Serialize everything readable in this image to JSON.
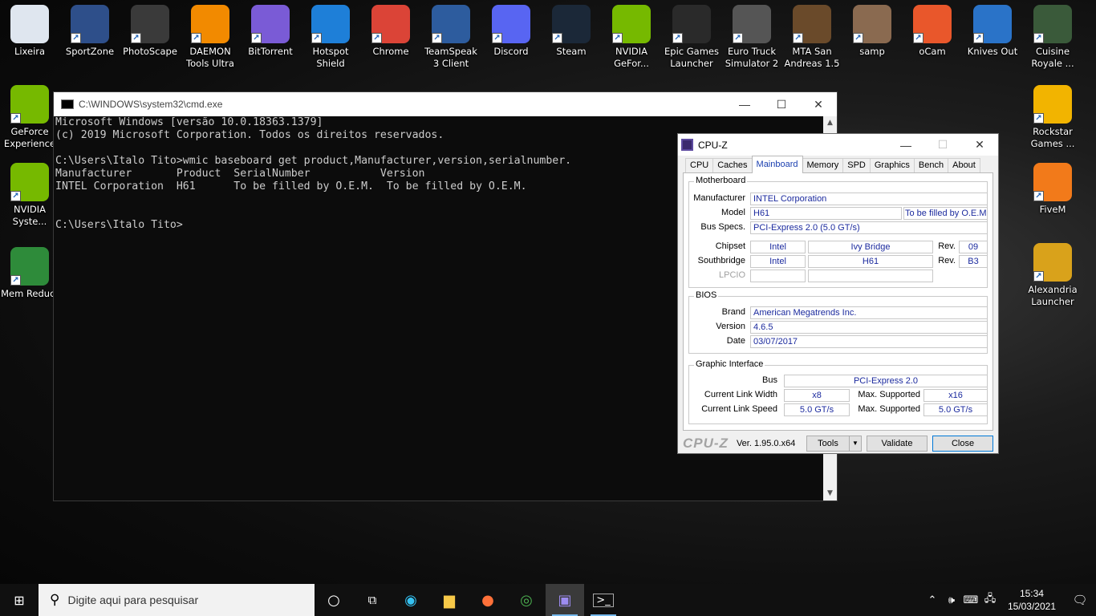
{
  "desktop_icons": [
    {
      "label": "Lixeira",
      "icon": "recycle-bin-icon",
      "color": "#dfe6ef"
    },
    {
      "label": "SportZone",
      "icon": "soccer-ball-icon",
      "color": "#2e4f8a"
    },
    {
      "label": "PhotoScape",
      "icon": "photoscape-icon",
      "color": "#3a3a3a"
    },
    {
      "label": "DAEMON Tools Ultra",
      "icon": "lightning-bolt-icon",
      "color": "#f28a00"
    },
    {
      "label": "BitTorrent",
      "icon": "bittorrent-icon",
      "color": "#7a5bd6"
    },
    {
      "label": "Hotspot Shield",
      "icon": "shield-icon",
      "color": "#1e7fd8"
    },
    {
      "label": "Chrome",
      "icon": "chrome-icon",
      "color": "#db4437"
    },
    {
      "label": "TeamSpeak 3 Client",
      "icon": "teamspeak-icon",
      "color": "#2d5c9e"
    },
    {
      "label": "Discord",
      "icon": "discord-icon",
      "color": "#5865f2"
    },
    {
      "label": "Steam",
      "icon": "steam-icon",
      "color": "#1b2838"
    },
    {
      "label": "NVIDIA GeFor...",
      "icon": "nvidia-icon",
      "color": "#76b900"
    },
    {
      "label": "Epic Games Launcher",
      "icon": "epic-games-icon",
      "color": "#2a2a2a"
    },
    {
      "label": "Euro Truck Simulator 2",
      "icon": "truck-icon",
      "color": "#555555"
    },
    {
      "label": "MTA San Andreas 1.5",
      "icon": "mta-icon",
      "color": "#6a4a2a"
    },
    {
      "label": "samp",
      "icon": "samp-icon",
      "color": "#8a6a50"
    },
    {
      "label": "oCam",
      "icon": "ocam-icon",
      "color": "#e9572b"
    },
    {
      "label": "Knives Out",
      "icon": "knives-out-icon",
      "color": "#2a73c8"
    },
    {
      "label": "Cuisine Royale ...",
      "icon": "cuisine-royale-icon",
      "color": "#3a5a3a"
    },
    {
      "label": "GeForce Experience",
      "icon": "nvidia-icon",
      "color": "#76b900"
    },
    {
      "label": "NVIDIA Syste...",
      "icon": "nvidia-icon",
      "color": "#76b900"
    },
    {
      "label": "Mem Reduct",
      "icon": "memory-chip-icon",
      "color": "#2e8b3a"
    },
    {
      "label": "Rockstar Games ...",
      "icon": "rockstar-icon",
      "color": "#f2b400"
    },
    {
      "label": "FiveM",
      "icon": "fivem-icon",
      "color": "#f27a1a"
    },
    {
      "label": "Alexandria Launcher",
      "icon": "alexandria-icon",
      "color": "#d9a21b"
    }
  ],
  "cmd": {
    "title": "C:\\WINDOWS\\system32\\cmd.exe",
    "lines": [
      "Microsoft Windows [versão 10.0.18363.1379]",
      "(c) 2019 Microsoft Corporation. Todos os direitos reservados.",
      "",
      "C:\\Users\\Italo Tito>wmic baseboard get product,Manufacturer,version,serialnumber.",
      "Manufacturer       Product  SerialNumber           Version",
      "INTEL Corporation  H61      To be filled by O.E.M.  To be filled by O.E.M.",
      "",
      "",
      "C:\\Users\\Italo Tito>"
    ]
  },
  "cpuz": {
    "title": "CPU-Z",
    "tabs": [
      "CPU",
      "Caches",
      "Mainboard",
      "Memory",
      "SPD",
      "Graphics",
      "Bench",
      "About"
    ],
    "active_tab": "Mainboard",
    "motherboard": {
      "group": "Motherboard",
      "manufacturer_label": "Manufacturer",
      "manufacturer": "INTEL Corporation",
      "model_label": "Model",
      "model": "H61",
      "model_rev": "To be filled by O.E.M.",
      "bus_label": "Bus Specs.",
      "bus": "PCI-Express 2.0 (5.0 GT/s)",
      "chipset_label": "Chipset",
      "chipset_vendor": "Intel",
      "chipset_name": "Ivy Bridge",
      "chipset_rev_label": "Rev.",
      "chipset_rev": "09",
      "south_label": "Southbridge",
      "south_vendor": "Intel",
      "south_name": "H61",
      "south_rev_label": "Rev.",
      "south_rev": "B3",
      "lpcio_label": "LPCIO"
    },
    "bios": {
      "group": "BIOS",
      "brand_label": "Brand",
      "brand": "American Megatrends Inc.",
      "version_label": "Version",
      "version": "4.6.5",
      "date_label": "Date",
      "date": "03/07/2017"
    },
    "graphic": {
      "group": "Graphic Interface",
      "bus_label": "Bus",
      "bus": "PCI-Express 2.0",
      "width_label": "Current Link Width",
      "width": "x8",
      "max_label": "Max. Supported",
      "max_width": "x16",
      "speed_label": "Current Link Speed",
      "speed": "5.0 GT/s",
      "max_speed": "5.0 GT/s"
    },
    "footer": {
      "logo": "CPU-Z",
      "version": "Ver. 1.95.0.x64",
      "tools": "Tools",
      "validate": "Validate",
      "close": "Close"
    }
  },
  "taskbar": {
    "search_placeholder": "Digite aqui para pesquisar",
    "time": "15:34",
    "date": "15/03/2021"
  }
}
